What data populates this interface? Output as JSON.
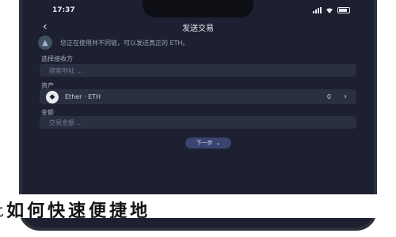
{
  "status_bar": {
    "time": "17:37"
  },
  "nav": {
    "back_icon": "chevron-left",
    "title": "发送交易"
  },
  "notice": {
    "icon": "warning-triangle",
    "text": "您正在使用并不同链，可以发送真正的 ETH。"
  },
  "network": {
    "label": "选择接收方",
    "placeholder": "搜索地址 …"
  },
  "asset": {
    "label": "资产",
    "name": "Ether · ETH",
    "balance": "0",
    "icon": "ethereum-icon"
  },
  "amount": {
    "label": "金额",
    "placeholder": "交易金额 …"
  },
  "next_button": {
    "label": "下一步",
    "icon": "chevron-down"
  },
  "banner": {
    "text": "t如何快速便捷地"
  },
  "colors": {
    "screen_bg": "#1c2030",
    "field_bg": "#2a3042",
    "accent": "#3a4470"
  }
}
